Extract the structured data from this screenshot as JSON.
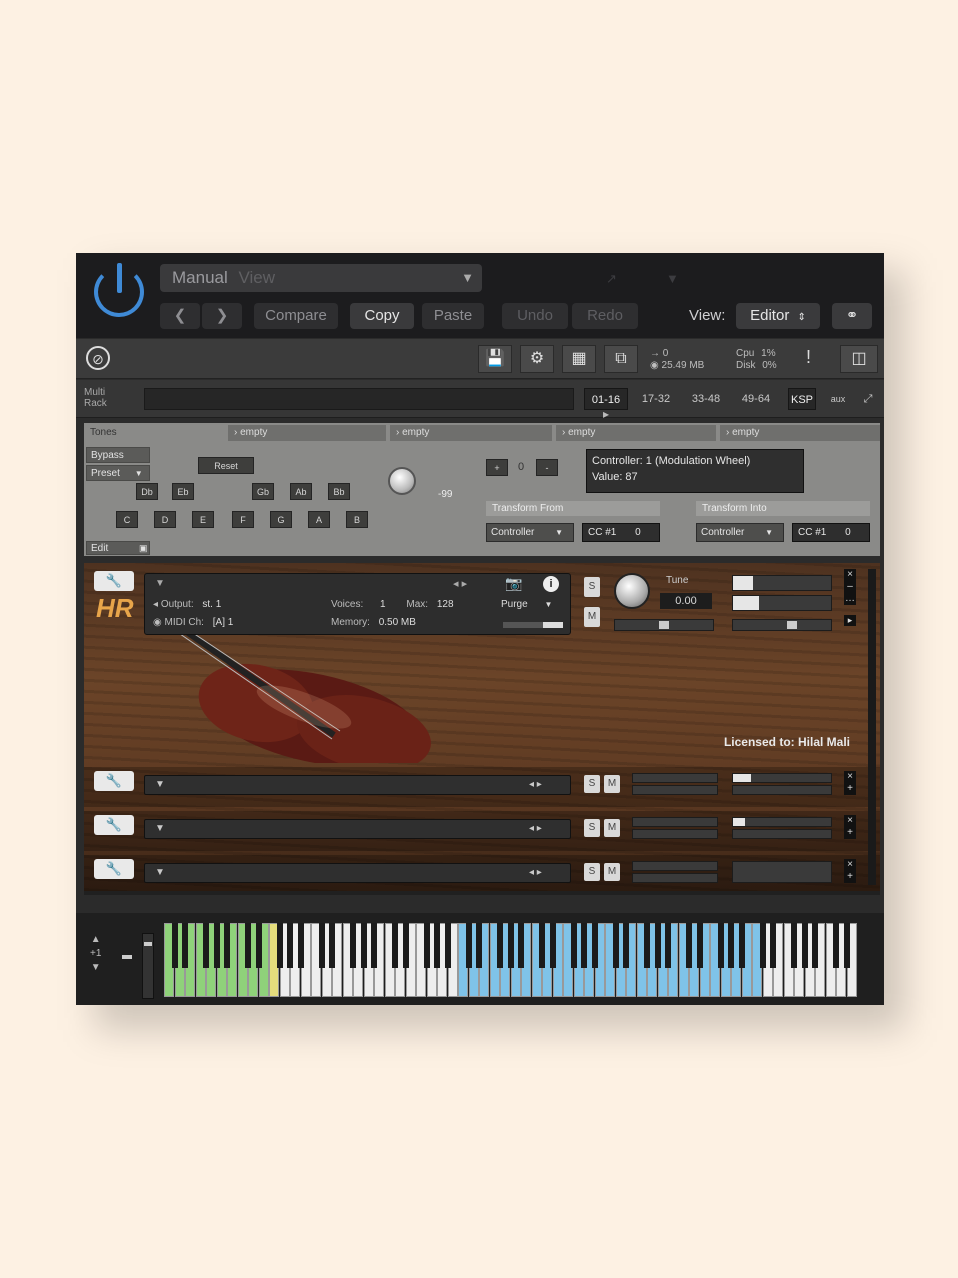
{
  "host": {
    "preset_name": "Manual",
    "preset_suffix": "View",
    "compare": "Compare",
    "copy": "Copy",
    "paste": "Paste",
    "undo": "Undo",
    "redo": "Redo",
    "view_label": "View:",
    "view_value": "Editor",
    "prev_icon": "chevron-left-icon",
    "next_icon": "chevron-right-icon",
    "link_icon": "link-icon",
    "power_color": "#3f8ad6"
  },
  "kontakt_toolbar": {
    "voices_label": "→ 0",
    "memory": "25.49 MB",
    "cpu_label": "Cpu",
    "cpu_value": "1%",
    "disk_label": "Disk",
    "disk_value": "0%",
    "alert": "!"
  },
  "rack": {
    "label_line1": "Multi",
    "label_line2": "Rack",
    "pages": [
      "01-16",
      "17-32",
      "33-48",
      "49-64",
      "KSP",
      "aux"
    ]
  },
  "script": {
    "tabs": [
      "Tones",
      "empty",
      "empty",
      "empty",
      "empty"
    ],
    "bypass": "Bypass",
    "preset": "Preset",
    "reset": "Reset",
    "edit": "Edit",
    "sharp_row": [
      "Db",
      "Eb",
      "Gb",
      "Ab",
      "Bb"
    ],
    "natural_row": [
      "C",
      "D",
      "E",
      "F",
      "G",
      "A",
      "B"
    ],
    "knob_value": "-99",
    "octave_plus": "+",
    "octave_value": "0",
    "octave_minus": "-",
    "info_line1": "Controller: 1 (Modulation Wheel)",
    "info_line2": "Value: 87",
    "transform_from": "Transform From",
    "transform_into": "Transform Into",
    "from_type": "Controller",
    "from_cc": "CC #1",
    "from_val": "0",
    "into_type": "Controller",
    "into_cc": "CC #1",
    "into_val": "0"
  },
  "instrument": {
    "output_label": "Output:",
    "output_value": "st. 1",
    "voices_label": "Voices:",
    "voices_value": "1",
    "max_label": "Max:",
    "max_value": "128",
    "purge": "Purge",
    "midi_label": "MIDI Ch:",
    "midi_value": "[A] 1",
    "memory_label": "Memory:",
    "memory_value": "0.50 MB",
    "tune_label": "Tune",
    "tune_value": "0.00",
    "solo": "S",
    "mute": "M",
    "license": "Licensed to: Hilal Mali",
    "logo": "HR"
  },
  "empty_rows": [
    {
      "s": "S",
      "m": "M"
    },
    {
      "s": "S",
      "m": "M"
    },
    {
      "s": "S",
      "m": "M"
    }
  ],
  "keyboard": {
    "zone_colors": {
      "green": "#8fd27a",
      "yellow": "#e5dd7c",
      "blue": "#7fc3e8",
      "white": "#eeeeee"
    },
    "pitch_label": "+1"
  }
}
